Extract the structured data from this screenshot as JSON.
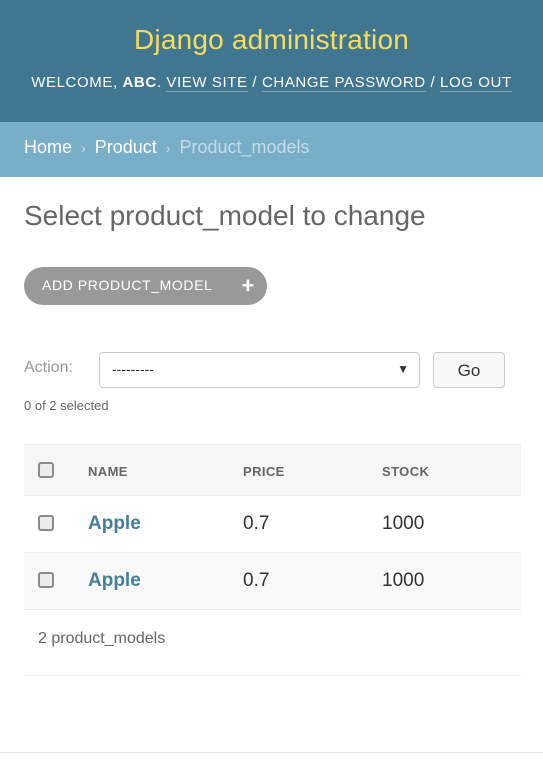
{
  "header": {
    "site_title": "Django administration",
    "welcome_prefix": "Welcome,",
    "username": "ABC",
    "view_site": "View site",
    "change_password": "Change password",
    "log_out": "Log out",
    "separator": "/"
  },
  "breadcrumbs": {
    "home": "Home",
    "app": "Product",
    "current": "Product_models",
    "separator": "›"
  },
  "page": {
    "title": "Select product_model to change",
    "add_button_label": "ADD PRODUCT_MODEL",
    "add_icon": "plus-icon"
  },
  "actions": {
    "label": "Action:",
    "selected_value": "---------",
    "go_label": "Go",
    "selected_count": "0 of 2 selected"
  },
  "table": {
    "columns": [
      "NAME",
      "PRICE",
      "STOCK"
    ],
    "rows": [
      {
        "name": "Apple",
        "price": "0.7",
        "stock": "1000"
      },
      {
        "name": "Apple",
        "price": "0.7",
        "stock": "1000"
      }
    ],
    "paginator": "2 product_models"
  },
  "colors": {
    "header_bg": "#417690",
    "branding": "#f5dd5d",
    "breadcrumbs_bg": "#79aec8",
    "link": "#447e9b"
  }
}
